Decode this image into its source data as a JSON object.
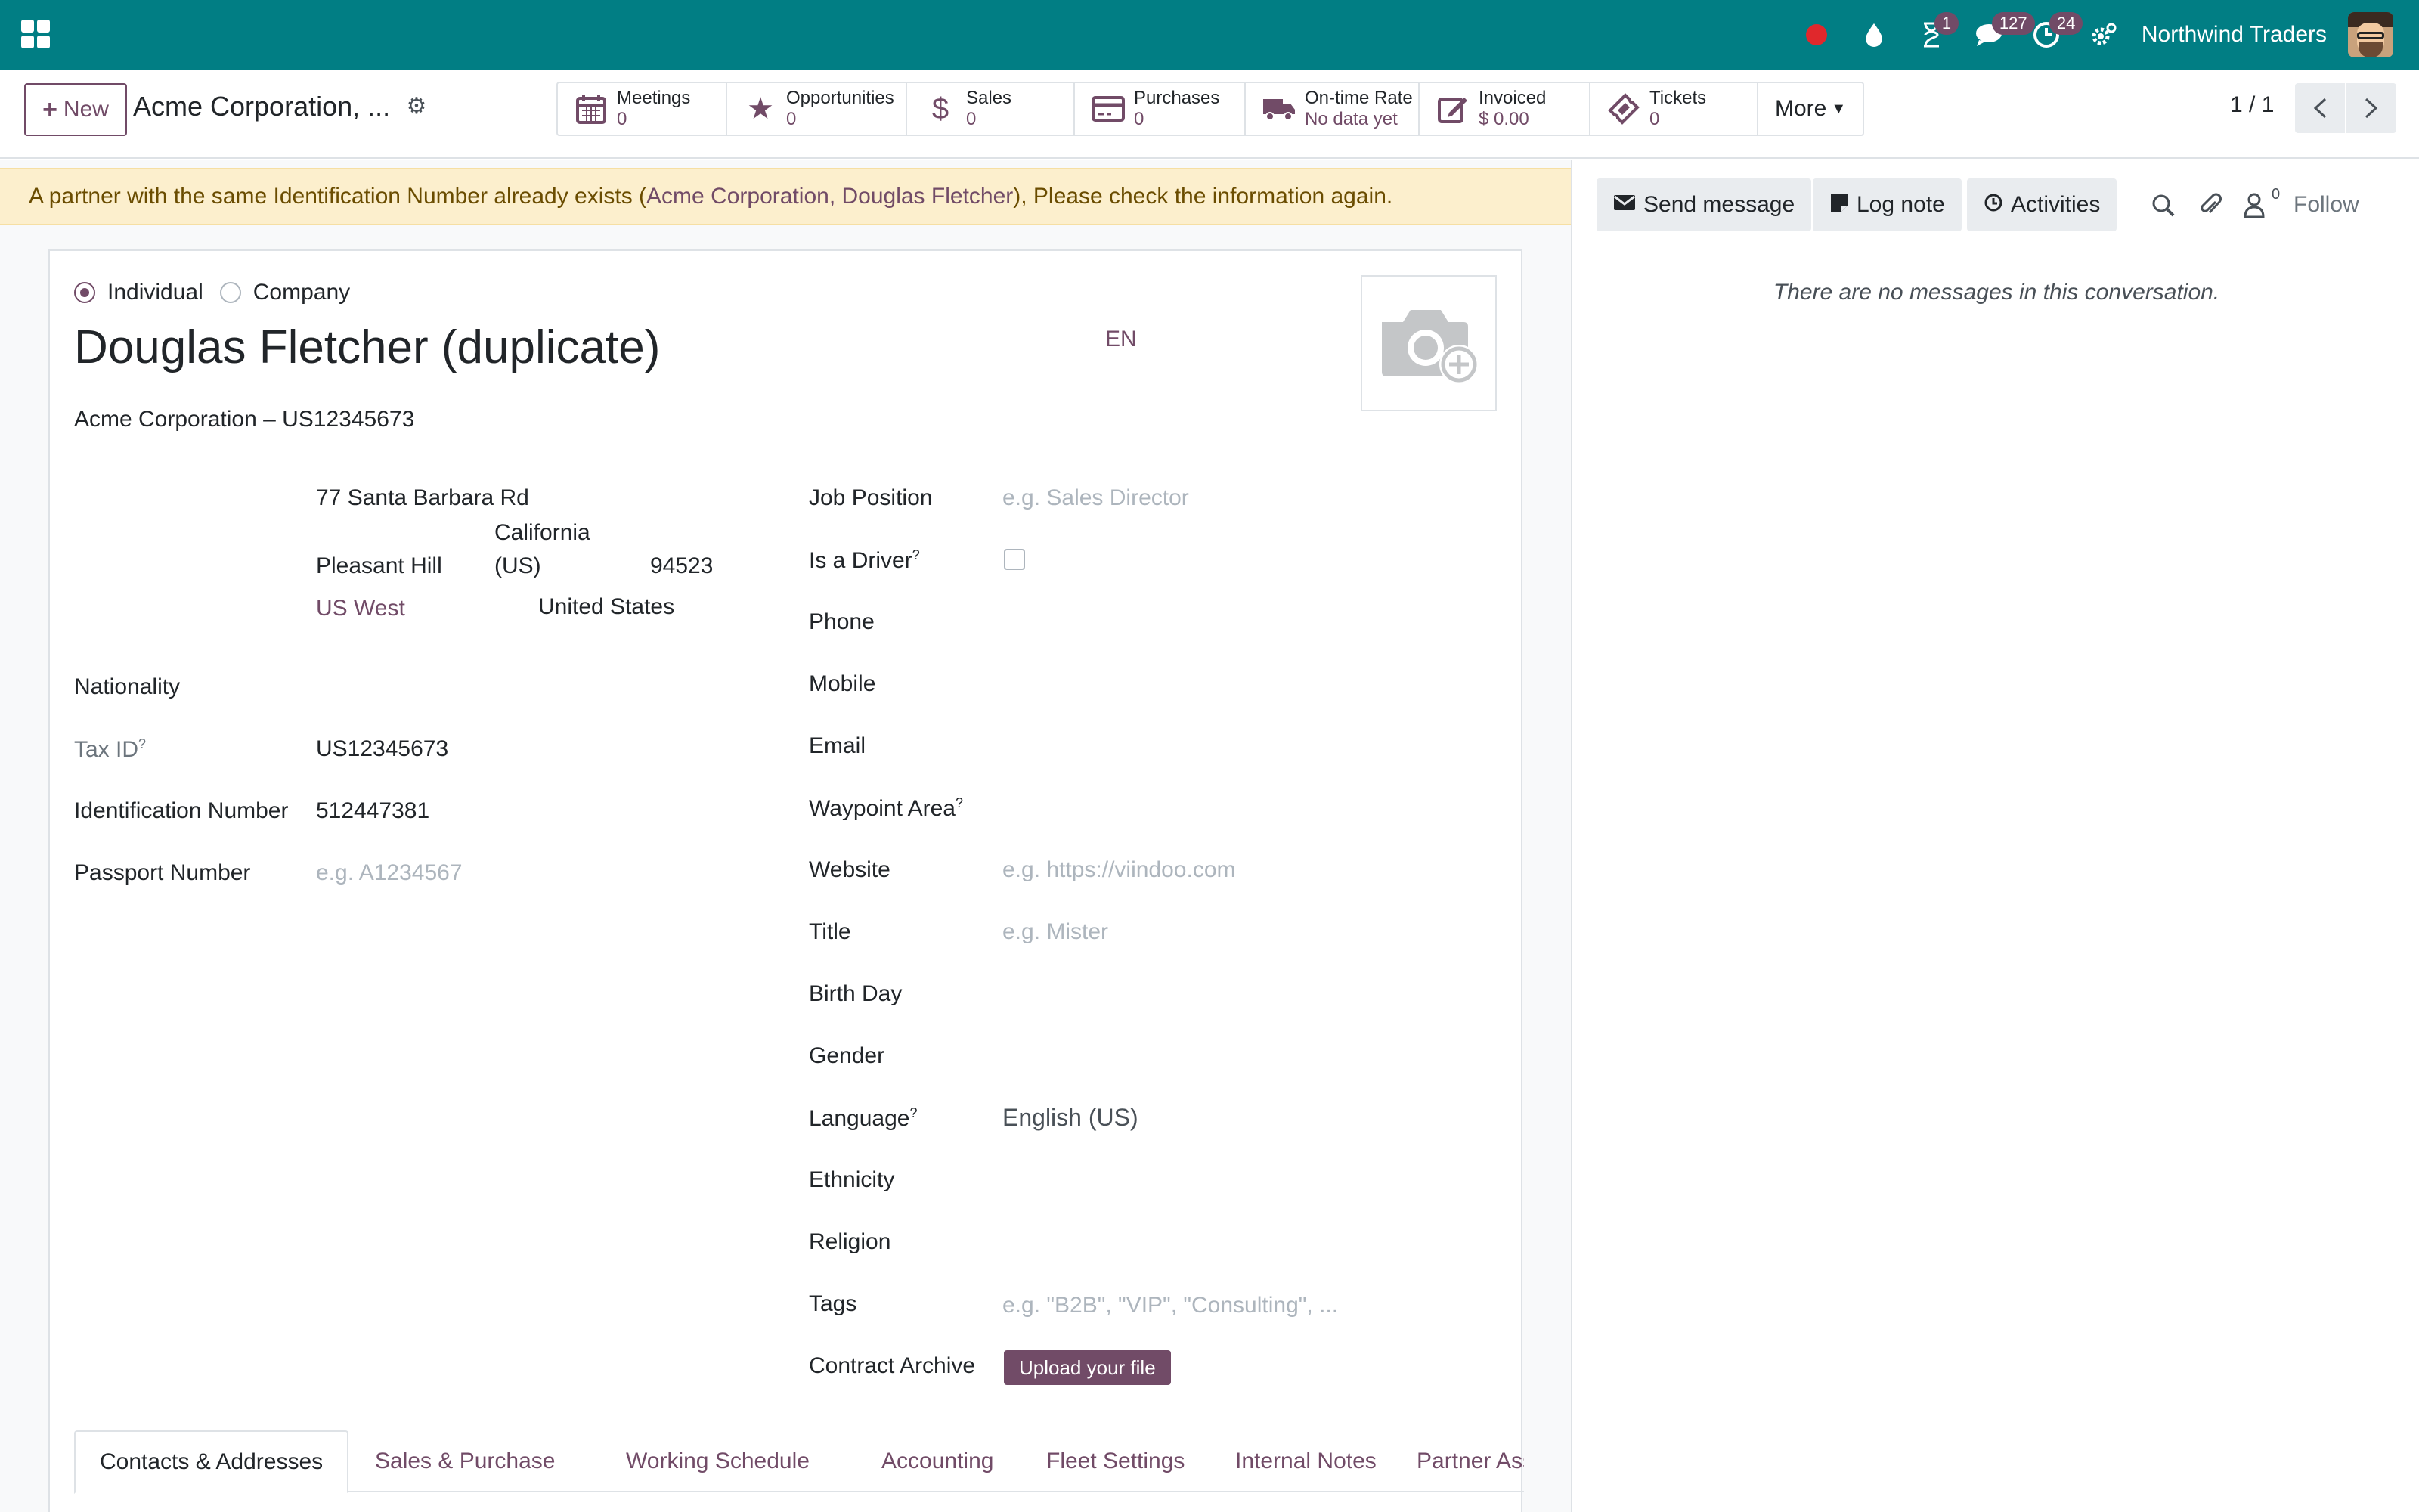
{
  "navbar": {
    "company_name": "Northwind Traders",
    "activity_badge": "1",
    "messages_badge": "127",
    "clock_badge": "24",
    "icons": [
      "apps-icon",
      "record-icon",
      "drop-icon",
      "hourglass-icon",
      "chat-icon",
      "clock-icon",
      "settings-icon"
    ]
  },
  "control_panel": {
    "new_label": "New",
    "breadcrumb": "Acme Corporation, ...",
    "pager": "1 / 1",
    "smart_buttons": [
      {
        "label": "Meetings",
        "value": "0",
        "icon": "calendar-icon"
      },
      {
        "label": "Opportunities",
        "value": "0",
        "icon": "star-icon"
      },
      {
        "label": "Sales",
        "value": "0",
        "icon": "dollar-icon"
      },
      {
        "label": "Purchases",
        "value": "0",
        "icon": "credit-card-icon"
      },
      {
        "label": "On-time Rate",
        "value": "No data yet",
        "icon": "truck-icon"
      },
      {
        "label": "Invoiced",
        "value": "$ 0.00",
        "icon": "edit-icon"
      },
      {
        "label": "Tickets",
        "value": "0",
        "icon": "ticket-icon"
      }
    ],
    "more_label": "More"
  },
  "alert": {
    "text_before": "A partner with the same Identification Number already exists (",
    "link_text": "Acme Corporation, Douglas Fletcher",
    "text_after": "), Please check the information again."
  },
  "form": {
    "type_individual": "Individual",
    "type_company": "Company",
    "name": "Douglas Fletcher (duplicate)",
    "lang_code": "EN",
    "company_line": "Acme Corporation – US12345673",
    "address": {
      "street": "77 Santa Barbara Rd",
      "city": "Pleasant Hill",
      "state_line1": "California",
      "state_line2": "(US)",
      "zip": "94523",
      "region": "US West",
      "country": "United States"
    },
    "left_fields": {
      "nationality_label": "Nationality",
      "tax_id_label": "Tax ID",
      "tax_id_value": "US12345673",
      "identification_label": "Identification Number",
      "identification_value": "512447381",
      "passport_label": "Passport Number",
      "passport_placeholder": "e.g. A1234567"
    },
    "right_fields": {
      "job_position_label": "Job Position",
      "job_position_placeholder": "e.g. Sales Director",
      "driver_label": "Is a Driver",
      "phone_label": "Phone",
      "mobile_label": "Mobile",
      "email_label": "Email",
      "waypoint_label": "Waypoint Area",
      "website_label": "Website",
      "website_placeholder": "e.g. https://viindoo.com",
      "title_label": "Title",
      "title_placeholder": "e.g. Mister",
      "birthday_label": "Birth Day",
      "gender_label": "Gender",
      "language_label": "Language",
      "language_value": "English (US)",
      "ethnicity_label": "Ethnicity",
      "religion_label": "Religion",
      "tags_label": "Tags",
      "tags_placeholder": "e.g. \"B2B\", \"VIP\", \"Consulting\", ...",
      "contract_label": "Contract Archive",
      "upload_label": "Upload your file"
    },
    "help_mark": "?",
    "tabs": [
      "Contacts & Addresses",
      "Sales & Purchase",
      "Working Schedule",
      "Accounting",
      "Fleet Settings",
      "Internal Notes",
      "Partner Assign"
    ]
  },
  "chatter": {
    "send_message": "Send message",
    "log_note": "Log note",
    "activities": "Activities",
    "follower_count": "0",
    "follow": "Follow",
    "empty_text": "There are no messages in this conversation."
  },
  "colors": {
    "navbar": "#017e84",
    "brand": "#714b67",
    "alert_bg": "#fcefcd"
  }
}
